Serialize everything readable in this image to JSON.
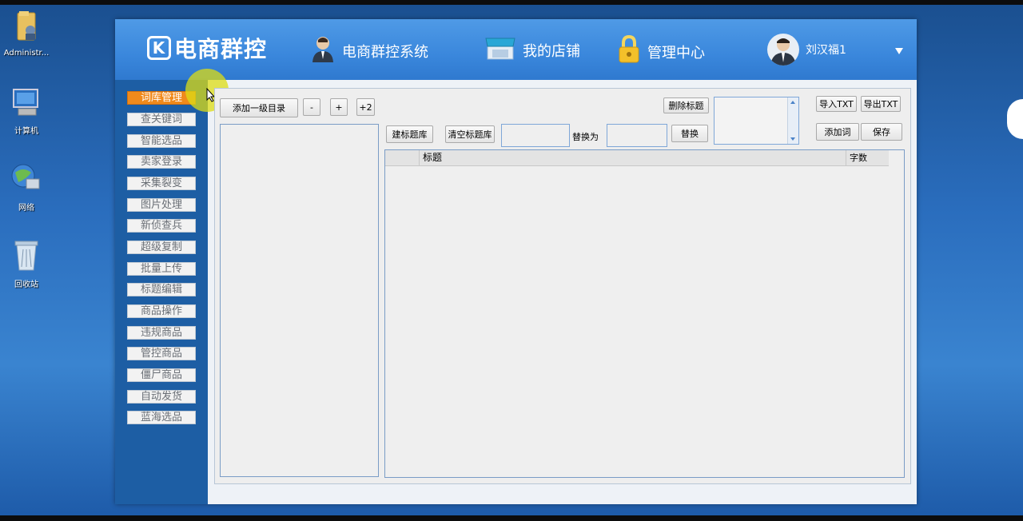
{
  "desktop": {
    "icons": [
      {
        "label": "Administr..."
      },
      {
        "label": "计算机"
      },
      {
        "label": "网络"
      },
      {
        "label": "回收站"
      }
    ]
  },
  "header": {
    "logo_mark": "K",
    "logo_text": "电商群控",
    "nav": [
      {
        "label": "电商群控系统"
      },
      {
        "label": "我的店铺"
      },
      {
        "label": "管理中心"
      }
    ],
    "user_name": "刘汉福1"
  },
  "sidebar": {
    "items": [
      {
        "label": "词库管理",
        "active": true
      },
      {
        "label": "查关键词"
      },
      {
        "label": "智能选品"
      },
      {
        "label": "卖家登录"
      },
      {
        "label": "采集裂变"
      },
      {
        "label": "图片处理"
      },
      {
        "label": "新侦查兵"
      },
      {
        "label": "超级复制"
      },
      {
        "label": "批量上传"
      },
      {
        "label": "标题编辑"
      },
      {
        "label": "商品操作"
      },
      {
        "label": "违规商品"
      },
      {
        "label": "管控商品"
      },
      {
        "label": "僵尸商品"
      },
      {
        "label": "自动发货"
      },
      {
        "label": "蓝海选品"
      }
    ]
  },
  "toolbar": {
    "add_dir": "添加一级目录",
    "minus": "-",
    "plus": "+",
    "plus2": "+2",
    "delete_title": "删除标题",
    "import_txt": "导入TXT",
    "export_txt": "导出TXT",
    "add_word": "添加词",
    "save": "保存",
    "build_lib": "建标题库",
    "clear_lib": "清空标题库",
    "replace_as": "替换为",
    "replace": "替换"
  },
  "grid": {
    "columns": [
      "标题",
      "字数"
    ]
  },
  "colors": {
    "header_blue": "#3a87dc",
    "sidebar_blue": "#1d5ea4",
    "active_orange": "#f08a1c"
  }
}
